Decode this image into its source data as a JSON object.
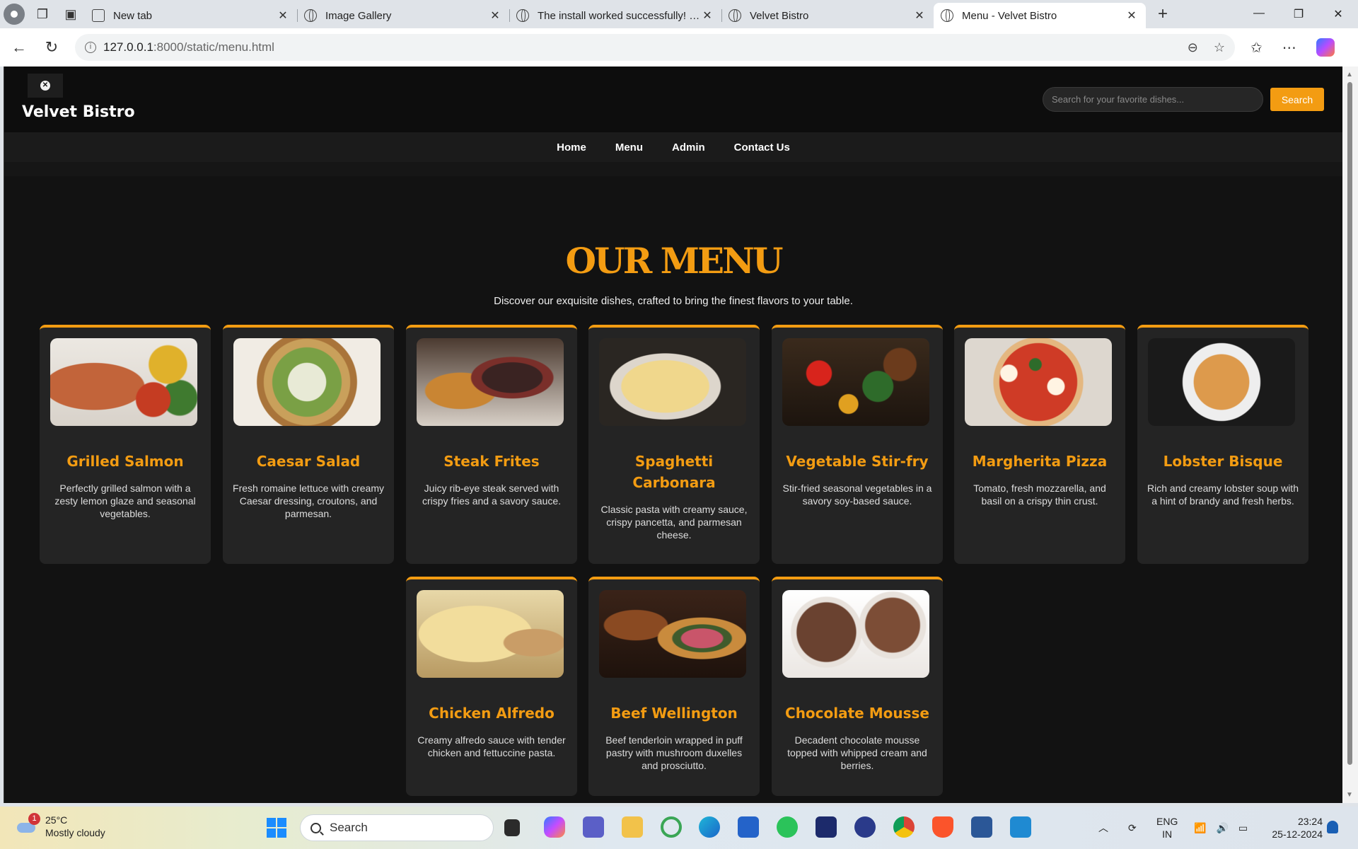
{
  "browser": {
    "tabs": [
      {
        "title": "New tab"
      },
      {
        "title": "Image Gallery"
      },
      {
        "title": "The install worked successfully! Co"
      },
      {
        "title": "Velvet Bistro"
      },
      {
        "title": "Menu - Velvet Bistro"
      }
    ],
    "url_host": "127.0.0.1",
    "url_path": ":8000/static/menu.html"
  },
  "site": {
    "brand": "Velvet Bistro",
    "search_placeholder": "Search for your favorite dishes...",
    "search_button": "Search",
    "nav": [
      "Home",
      "Menu",
      "Admin",
      "Contact Us"
    ]
  },
  "menu": {
    "title": "OUR MENU",
    "subtitle": "Discover our exquisite dishes, crafted to bring the finest flavors to your table.",
    "items": [
      {
        "name": "Grilled Salmon",
        "description": "Perfectly grilled salmon with a zesty lemon glaze and seasonal vegetables."
      },
      {
        "name": "Caesar Salad",
        "description": "Fresh romaine lettuce with creamy Caesar dressing, croutons, and parmesan."
      },
      {
        "name": "Steak Frites",
        "description": "Juicy rib-eye steak served with crispy fries and a savory sauce."
      },
      {
        "name": "Spaghetti Carbonara",
        "description": "Classic pasta with creamy sauce, crispy pancetta, and parmesan cheese."
      },
      {
        "name": "Vegetable Stir-fry",
        "description": "Stir-fried seasonal vegetables in a savory soy-based sauce."
      },
      {
        "name": "Margherita Pizza",
        "description": "Tomato, fresh mozzarella, and basil on a crispy thin crust."
      },
      {
        "name": "Lobster Bisque",
        "description": "Rich and creamy lobster soup with a hint of brandy and fresh herbs."
      },
      {
        "name": "Chicken Alfredo",
        "description": "Creamy alfredo sauce with tender chicken and fettuccine pasta."
      },
      {
        "name": "Beef Wellington",
        "description": "Beef tenderloin wrapped in puff pastry with mushroom duxelles and prosciutto."
      },
      {
        "name": "Chocolate Mousse",
        "description": "Decadent chocolate mousse topped with whipped cream and berries."
      }
    ]
  },
  "taskbar": {
    "weather_temp": "25°C",
    "weather_desc": "Mostly cloudy",
    "weather_badge": "1",
    "search_label": "Search",
    "lang_line1": "ENG",
    "lang_line2": "IN",
    "time": "23:24",
    "date": "25-12-2024"
  }
}
